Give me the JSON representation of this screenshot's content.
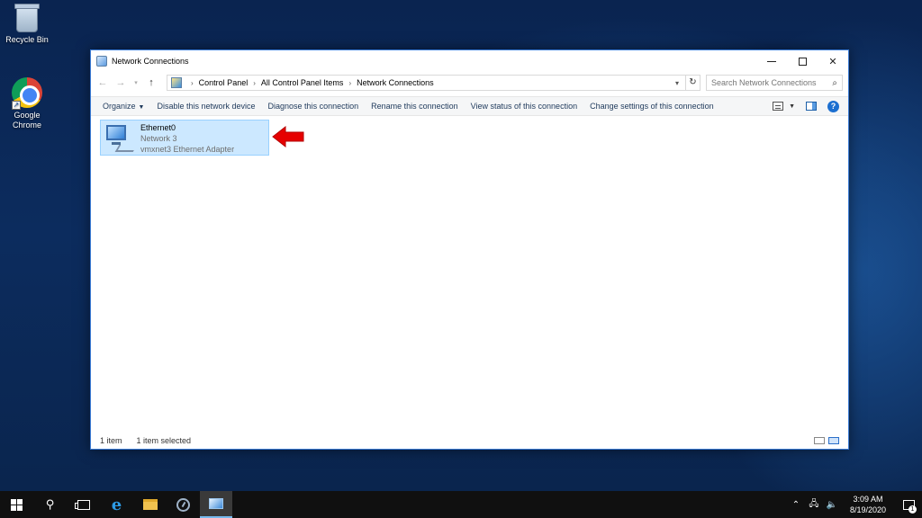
{
  "desktop": {
    "icons": [
      {
        "label": "Recycle Bin",
        "icon": "recycle-bin-icon"
      },
      {
        "label": "Google Chrome",
        "icon": "chrome-icon"
      }
    ]
  },
  "window": {
    "title": "Network Connections",
    "controls": {
      "minimize": "minimize",
      "maximize": "maximize",
      "close": "✕"
    },
    "breadcrumb": [
      "Control Panel",
      "All Control Panel Items",
      "Network Connections"
    ],
    "search": {
      "placeholder": "Search Network Connections"
    },
    "commands": {
      "organize": "Organize",
      "disable": "Disable this network device",
      "diagnose": "Diagnose this connection",
      "rename": "Rename this connection",
      "view_status": "View status of this connection",
      "change_settings": "Change settings of this connection"
    },
    "adapter": {
      "name": "Ethernet0",
      "network": "Network  3",
      "device": "vmxnet3 Ethernet Adapter"
    },
    "status": {
      "count": "1 item",
      "selected": "1 item selected"
    }
  },
  "annotation": {
    "color": "#e60000",
    "icon": "red-arrow-pointer"
  },
  "taskbar": {
    "clock": {
      "time": "3:09 AM",
      "date": "8/19/2020"
    },
    "notification_count": "1"
  }
}
